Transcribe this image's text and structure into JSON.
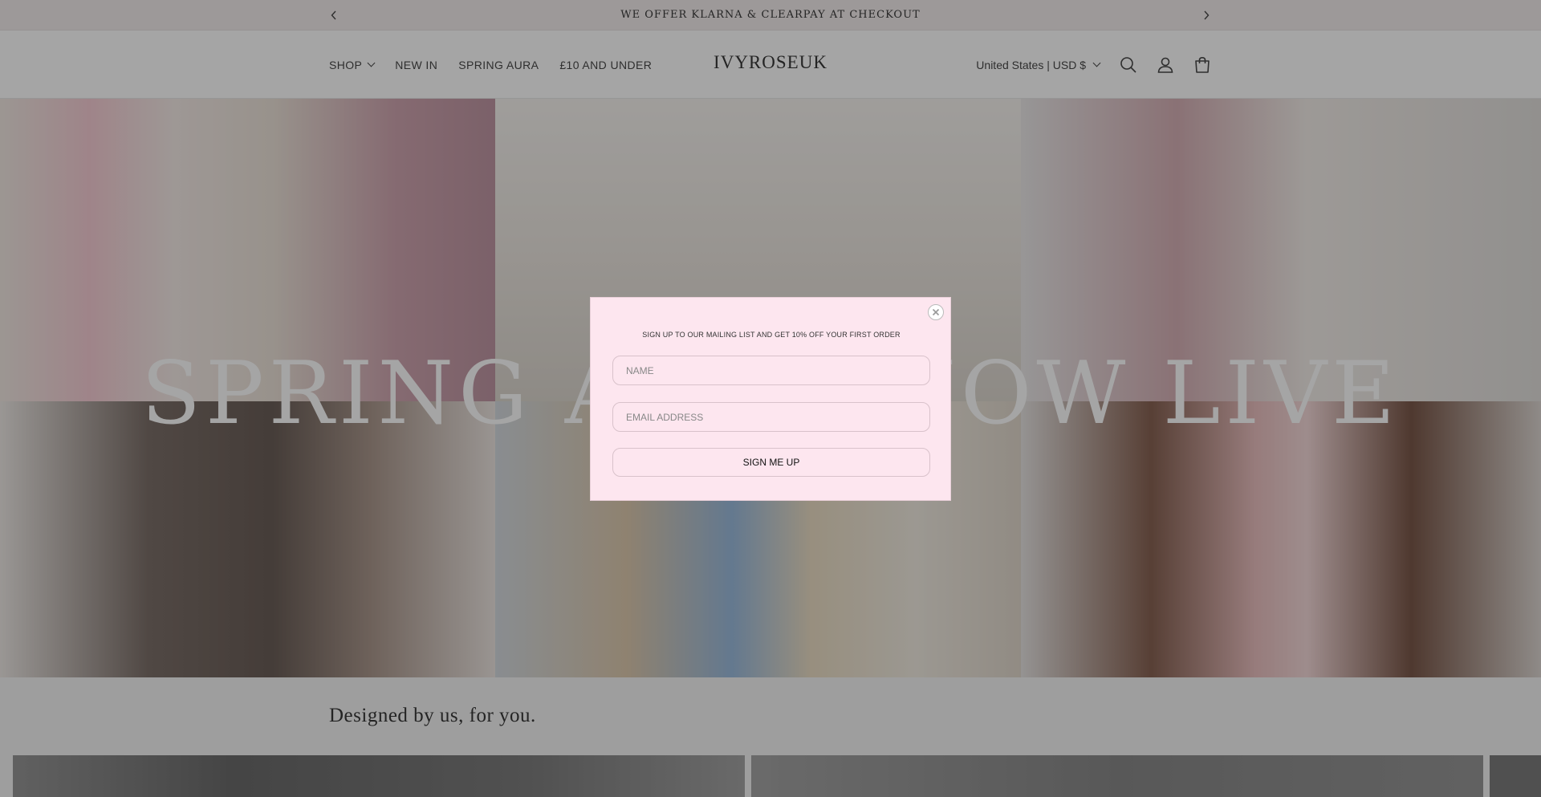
{
  "announcement": {
    "message": "WE OFFER KLARNA & CLEARPAY AT CHECKOUT",
    "prev_icon": "chevron-left-icon",
    "next_icon": "chevron-right-icon"
  },
  "header": {
    "logo": "IVYROSEUK",
    "nav": [
      {
        "label": "SHOP",
        "has_dropdown": true
      },
      {
        "label": "NEW IN"
      },
      {
        "label": "SPRING AURA"
      },
      {
        "label": "£10 AND UNDER"
      }
    ],
    "country_selector": "United States | USD $",
    "icons": [
      "search-icon",
      "account-icon",
      "cart-icon"
    ]
  },
  "hero": {
    "title": "SPRING AURA NOW LIVE"
  },
  "section": {
    "heading": "Designed by us, for you."
  },
  "popup": {
    "headline": "SIGN UP TO OUR MAILING LIST AND GET 10% OFF YOUR FIRST ORDER",
    "name_placeholder": "NAME",
    "email_placeholder": "EMAIL ADDRESS",
    "submit_label": "SIGN ME UP",
    "background_color": "#fde6ef"
  }
}
